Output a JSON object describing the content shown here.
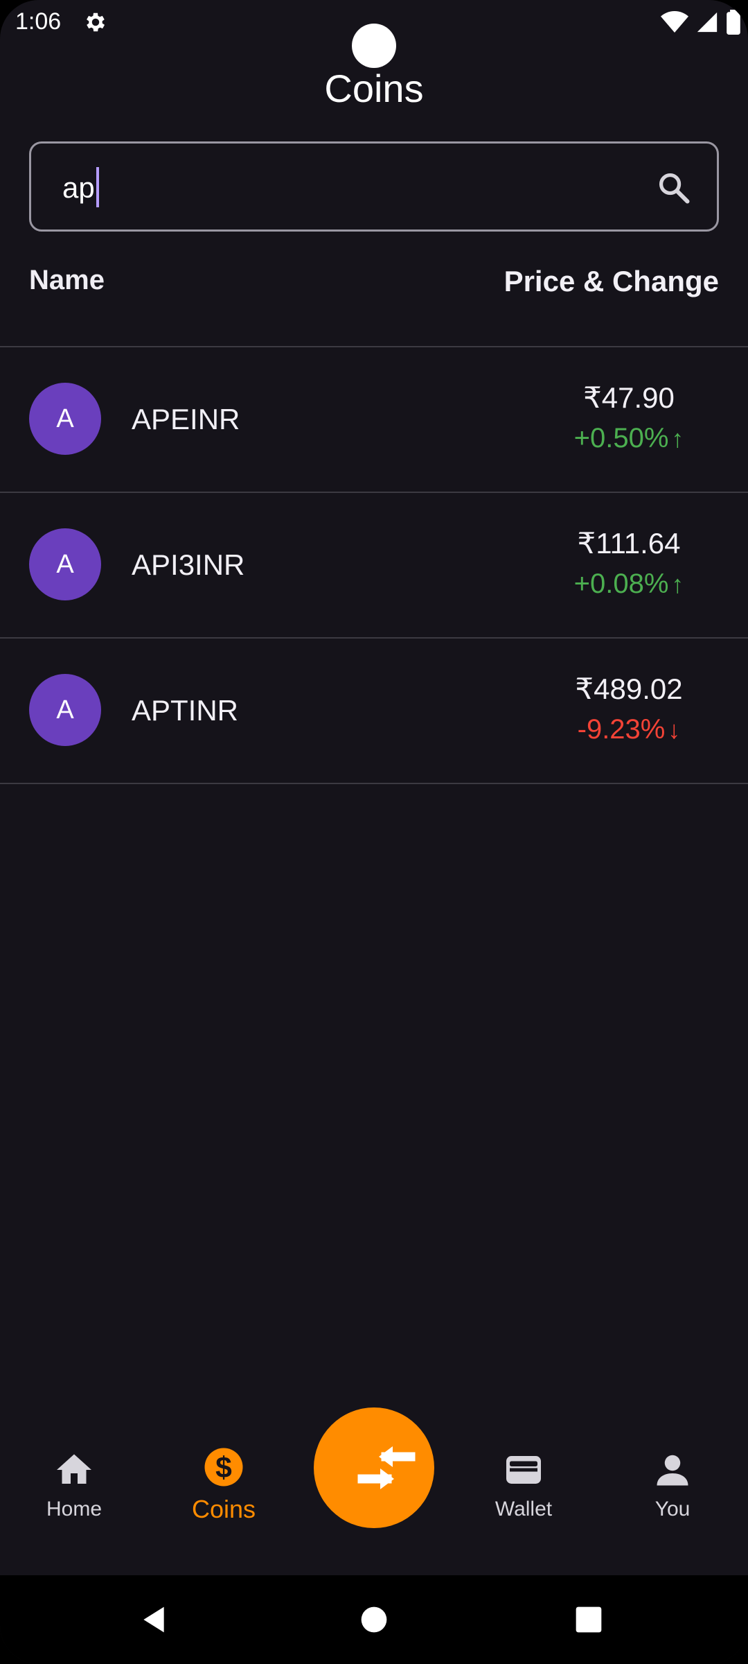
{
  "status_bar": {
    "time": "1:06"
  },
  "title": "Coins",
  "search": {
    "value": "ap"
  },
  "table": {
    "col_name": "Name",
    "col_price": "Price & Change"
  },
  "coins": [
    {
      "avatar": "A",
      "name": "APEINR",
      "price": "₹47.90",
      "change": "+0.50%",
      "direction": "up"
    },
    {
      "avatar": "A",
      "name": "API3INR",
      "price": "₹111.64",
      "change": "+0.08%",
      "direction": "up"
    },
    {
      "avatar": "A",
      "name": "APTINR",
      "price": "₹489.02",
      "change": "-9.23%",
      "direction": "down"
    }
  ],
  "nav": {
    "home": "Home",
    "coins": "Coins",
    "wallet": "Wallet",
    "you": "You"
  },
  "colors": {
    "background": "#15131a",
    "accent": "#ff8c00",
    "avatar": "#6a3fbd",
    "up": "#4caf50",
    "down": "#f44336"
  },
  "icons": [
    "gear-icon",
    "wifi-icon",
    "signal-icon",
    "battery-icon",
    "search-icon",
    "home-icon",
    "dollar-coin-icon",
    "swap-arrows-icon",
    "wallet-icon",
    "person-icon",
    "back-icon",
    "home-circle-icon",
    "recents-icon"
  ]
}
